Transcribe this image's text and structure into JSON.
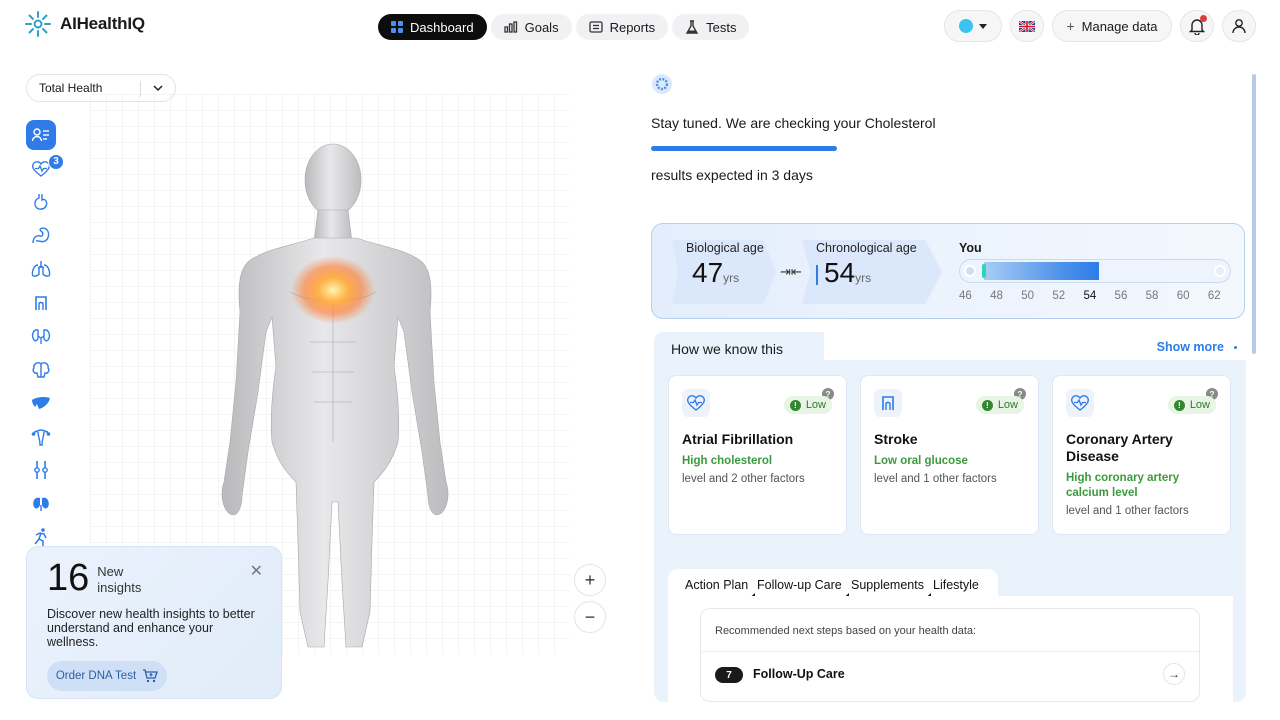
{
  "app": {
    "name": "AIHealthIQ"
  },
  "nav": {
    "tabs": [
      {
        "label": "Dashboard",
        "icon": "grid-icon",
        "active": true
      },
      {
        "label": "Goals",
        "icon": "bar-chart-icon",
        "active": false
      },
      {
        "label": "Reports",
        "icon": "document-icon",
        "active": false
      },
      {
        "label": "Tests",
        "icon": "flask-icon",
        "active": false
      }
    ]
  },
  "toolbar": {
    "manage_data_label": "Manage data",
    "language_flag": "🇬🇧",
    "notifications_has_unread": true
  },
  "left": {
    "select_value": "Total Health",
    "organ_badge": "3",
    "organs": [
      "profile",
      "heart",
      "stomach",
      "intestine",
      "lungs",
      "colon",
      "kidneys",
      "brain",
      "liver",
      "uterus",
      "joints",
      "thyroid",
      "muscle"
    ],
    "zoom_in": "+",
    "zoom_out": "−",
    "insights": {
      "count": "16",
      "label_line1": "New",
      "label_line2": "insights",
      "body": "Discover new health insights to better understand and enhance your wellness.",
      "button_label": "Order DNA Test"
    }
  },
  "right": {
    "status_text": "Stay tuned. We are checking your Cholesterol",
    "progress_fraction": 0.31,
    "expected_text": "results expected in 3 days",
    "age": {
      "bio_title": "Biological age",
      "bio_value": "47",
      "bio_unit": "yrs",
      "chrono_title": "Chronological age",
      "chrono_value": "54",
      "chrono_unit": "yrs",
      "you_label": "You",
      "ticks": [
        "46",
        "48",
        "50",
        "52",
        "54",
        "56",
        "58",
        "60",
        "62"
      ],
      "scale_min": 46,
      "scale_max": 62,
      "biological_age": 47,
      "chronological_age": 54
    },
    "know": {
      "title": "How we know this",
      "show_more": "Show more",
      "cards": [
        {
          "title": "Atrial Fibrillation",
          "risk": "Low",
          "factor": "High cholesterol",
          "rest": "level and 2 other factors",
          "icon": "heart-pulse-icon"
        },
        {
          "title": "Stroke",
          "risk": "Low",
          "factor": "Low oral glucose",
          "rest": "level and 1 other factors",
          "icon": "colon-icon"
        },
        {
          "title": "Coronary Artery Disease",
          "risk": "Low",
          "factor": "High coronary artery calcium level",
          "rest": "level and 1 other factors",
          "icon": "heart-pulse-icon"
        }
      ]
    },
    "plan": {
      "tabs": [
        "Action Plan",
        "Follow-up Care",
        "Supplements",
        "Lifestyle"
      ],
      "hint": "Recommended next steps based on your health data:",
      "item_count": "7",
      "item_label": "Follow-Up Care",
      "arrow": "→"
    }
  },
  "colors": {
    "accent": "#2f7be8",
    "risk_low": "#2f8a2f",
    "factor_green": "#3b9a3b"
  }
}
